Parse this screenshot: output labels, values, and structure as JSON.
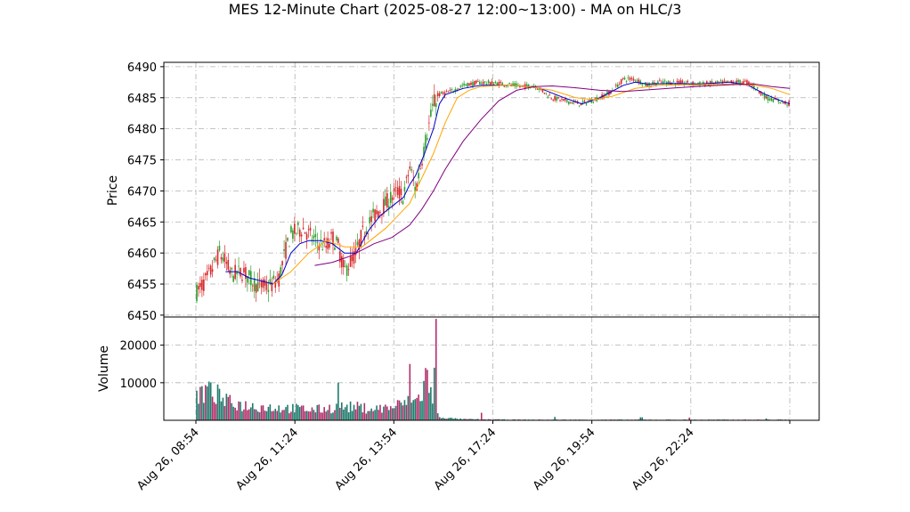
{
  "chart_data": {
    "type": "candlestick",
    "title": "MES 12-Minute Chart (2025-08-27 12:00~13:00) - MA on HLC/3",
    "price_panel": {
      "ylabel": "Price",
      "ylim": [
        6449.7,
        6490.7
      ],
      "yticks": [
        6450,
        6455,
        6460,
        6465,
        6470,
        6475,
        6480,
        6485,
        6490
      ],
      "grid": true
    },
    "volume_panel": {
      "ylabel": "Volume",
      "ylim": [
        0,
        27500
      ],
      "yticks": [
        10000,
        20000
      ],
      "grid": true
    },
    "x_index_range": [
      0,
      100
    ],
    "xticks": [
      {
        "i": 0,
        "label": "Aug 26, 08:54"
      },
      {
        "i": 16.67,
        "label": "Aug 26, 11:24"
      },
      {
        "i": 33.33,
        "label": "Aug 26, 13:54"
      },
      {
        "i": 50,
        "label": "Aug 26, 17:24"
      },
      {
        "i": 66.67,
        "label": "Aug 26, 19:54"
      },
      {
        "i": 83.33,
        "label": "Aug 26, 22:24"
      },
      {
        "i": 100,
        "label": ""
      }
    ],
    "colors": {
      "up": "#2ca02c",
      "down": "#d62728",
      "ma_fast": "#0000cc",
      "ma_mid": "#ffa500",
      "ma_slow": "#800080",
      "volume_a": "#1f7a6d",
      "volume_b": "#b0306a"
    },
    "price_path": [
      [
        0,
        6453.5
      ],
      [
        2,
        6456
      ],
      [
        3,
        6458
      ],
      [
        4,
        6460
      ],
      [
        5,
        6458.5
      ],
      [
        6,
        6456.5
      ],
      [
        8,
        6457
      ],
      [
        10,
        6455
      ],
      [
        12,
        6454.5
      ],
      [
        13,
        6455
      ],
      [
        14,
        6456
      ],
      [
        15,
        6460
      ],
      [
        16,
        6463
      ],
      [
        18,
        6464
      ],
      [
        20,
        6462
      ],
      [
        22,
        6461
      ],
      [
        23,
        6462.5
      ],
      [
        24,
        6461
      ],
      [
        25,
        6457
      ],
      [
        27,
        6460
      ],
      [
        28,
        6463
      ],
      [
        30,
        6466
      ],
      [
        32,
        6468
      ],
      [
        34,
        6470
      ],
      [
        35,
        6469
      ],
      [
        36,
        6474
      ],
      [
        37,
        6470
      ],
      [
        38,
        6475
      ],
      [
        40,
        6484
      ],
      [
        41,
        6485.5
      ],
      [
        43,
        6486
      ],
      [
        45,
        6487
      ],
      [
        48,
        6487.5
      ],
      [
        52,
        6487.2
      ],
      [
        55,
        6486.8
      ],
      [
        57,
        6487
      ],
      [
        60,
        6485
      ],
      [
        62,
        6484.5
      ],
      [
        65,
        6484
      ],
      [
        68,
        6485
      ],
      [
        70,
        6486
      ],
      [
        72,
        6488
      ],
      [
        74,
        6488
      ],
      [
        76,
        6487
      ],
      [
        78,
        6487.5
      ],
      [
        80,
        6487.5
      ],
      [
        85,
        6487.2
      ],
      [
        90,
        6487.5
      ],
      [
        93,
        6487.5
      ],
      [
        95,
        6486
      ],
      [
        96,
        6485
      ],
      [
        98,
        6484.5
      ],
      [
        100,
        6484
      ]
    ],
    "ma_fast_path": [
      [
        5,
        6457
      ],
      [
        7,
        6457
      ],
      [
        9,
        6456
      ],
      [
        11,
        6455.5
      ],
      [
        13,
        6455
      ],
      [
        14.5,
        6456.5
      ],
      [
        16,
        6460
      ],
      [
        17.5,
        6461.5
      ],
      [
        19,
        6462
      ],
      [
        21,
        6462
      ],
      [
        23,
        6461.5
      ],
      [
        25,
        6460
      ],
      [
        27,
        6460
      ],
      [
        29,
        6463.5
      ],
      [
        31,
        6466
      ],
      [
        33,
        6467.5
      ],
      [
        35,
        6469
      ],
      [
        36,
        6471
      ],
      [
        37,
        6472.5
      ],
      [
        38.5,
        6476
      ],
      [
        40,
        6480
      ],
      [
        41,
        6484
      ],
      [
        42,
        6485.5
      ],
      [
        45,
        6486.5
      ],
      [
        48,
        6487
      ],
      [
        52,
        6487
      ],
      [
        56,
        6486.8
      ],
      [
        58,
        6486.5
      ],
      [
        62,
        6485
      ],
      [
        65,
        6484
      ],
      [
        68,
        6485
      ],
      [
        70,
        6486
      ],
      [
        72,
        6487
      ],
      [
        74,
        6487.5
      ],
      [
        76,
        6487.2
      ],
      [
        80,
        6487.3
      ],
      [
        85,
        6487.2
      ],
      [
        90,
        6487.5
      ],
      [
        93,
        6487
      ],
      [
        96,
        6485.5
      ],
      [
        98.5,
        6484.5
      ],
      [
        100,
        6484
      ]
    ],
    "ma_mid_path": [
      [
        13,
        6455
      ],
      [
        16,
        6457
      ],
      [
        19,
        6460
      ],
      [
        22,
        6462
      ],
      [
        25,
        6461
      ],
      [
        28,
        6461
      ],
      [
        30,
        6462.5
      ],
      [
        32,
        6464
      ],
      [
        34,
        6466
      ],
      [
        36,
        6468
      ],
      [
        38,
        6472
      ],
      [
        40,
        6476
      ],
      [
        42,
        6481
      ],
      [
        44,
        6485
      ],
      [
        46,
        6486.2
      ],
      [
        48,
        6486.8
      ],
      [
        52,
        6487
      ],
      [
        56,
        6486.8
      ],
      [
        60,
        6486.2
      ],
      [
        64,
        6485
      ],
      [
        67,
        6484.7
      ],
      [
        70,
        6485.2
      ],
      [
        74,
        6486.5
      ],
      [
        78,
        6487
      ],
      [
        84,
        6487.1
      ],
      [
        90,
        6487.2
      ],
      [
        94,
        6487
      ],
      [
        97,
        6486.5
      ],
      [
        100,
        6485.5
      ]
    ],
    "ma_slow_path": [
      [
        20,
        6458
      ],
      [
        23,
        6458.5
      ],
      [
        26,
        6459.5
      ],
      [
        28,
        6460.5
      ],
      [
        30,
        6461.5
      ],
      [
        33,
        6462.5
      ],
      [
        36,
        6464.5
      ],
      [
        38,
        6467
      ],
      [
        40,
        6470
      ],
      [
        42,
        6473.5
      ],
      [
        45,
        6478
      ],
      [
        48,
        6481.5
      ],
      [
        51,
        6484.5
      ],
      [
        54,
        6486.2
      ],
      [
        57,
        6486.8
      ],
      [
        60,
        6486.9
      ],
      [
        64,
        6486.6
      ],
      [
        68,
        6486.2
      ],
      [
        72,
        6486
      ],
      [
        78,
        6486.4
      ],
      [
        84,
        6486.8
      ],
      [
        90,
        6487.1
      ],
      [
        94,
        6487.2
      ],
      [
        97,
        6486.8
      ],
      [
        100,
        6486.5
      ]
    ],
    "volume_path": [
      [
        0,
        7000
      ],
      [
        3,
        7500
      ],
      [
        5,
        5000
      ],
      [
        8,
        4000
      ],
      [
        12,
        3500
      ],
      [
        16,
        3200
      ],
      [
        20,
        2800
      ],
      [
        24,
        3500
      ],
      [
        27,
        3500
      ],
      [
        30,
        3000
      ],
      [
        33,
        3500
      ],
      [
        35,
        4500
      ],
      [
        37,
        5000
      ],
      [
        38,
        7000
      ],
      [
        39,
        13000
      ],
      [
        40,
        3000
      ],
      [
        41,
        900
      ],
      [
        43,
        500
      ],
      [
        45,
        300
      ],
      [
        48,
        250
      ],
      [
        55,
        150
      ],
      [
        65,
        150
      ],
      [
        75,
        150
      ],
      [
        85,
        150
      ],
      [
        100,
        150
      ]
    ],
    "volume_spikes": [
      [
        2,
        9000
      ],
      [
        24,
        10000
      ],
      [
        36,
        15000
      ],
      [
        40.4,
        27000
      ],
      [
        40.2,
        14000
      ],
      [
        48,
        2000
      ],
      [
        60.5,
        900
      ],
      [
        75,
        800
      ],
      [
        83,
        700
      ],
      [
        96,
        500
      ]
    ]
  }
}
